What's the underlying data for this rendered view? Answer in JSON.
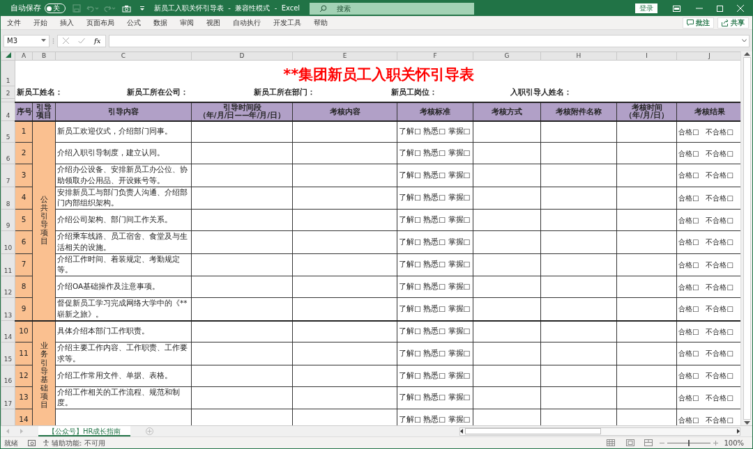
{
  "title_bar": {
    "autosave": {
      "label": "自动保存",
      "on": false,
      "state_text": "关"
    },
    "title": "新员工入职关怀引导表  -  兼容性模式  -  Excel",
    "search": {
      "placeholder": "搜索"
    },
    "signin": "登录"
  },
  "ribbon_tabs": [
    "文件",
    "开始",
    "插入",
    "页面布局",
    "公式",
    "数据",
    "审阅",
    "视图",
    "自动执行",
    "开发工具",
    "帮助"
  ],
  "ribbon_buttons": [
    {
      "kind": "comment",
      "label": "批注"
    },
    {
      "kind": "share",
      "label": "共享"
    }
  ],
  "formula_bar": {
    "name_box": "M3",
    "fx": "fx"
  },
  "column_headers": [
    "A",
    "B",
    "C",
    "D",
    "E",
    "F",
    "G",
    "H",
    "I",
    "J"
  ],
  "sheet": {
    "title": "**集团新员工入职关怀引导表",
    "top_rows": [
      "1",
      "2",
      "4"
    ],
    "info_labels": [
      "新员工姓名：",
      "新员工所在公司：",
      "新员工所在部门：",
      "新员工岗位：",
      "入职引导人姓名："
    ],
    "headings": [
      [
        "序号"
      ],
      [
        "引导",
        "项目"
      ],
      [
        "引导内容"
      ],
      [
        "引导时间段",
        "（年/月/日——年/月/日）"
      ],
      [
        "考核内容"
      ],
      [
        "考核标准"
      ],
      [
        "考核方式"
      ],
      [
        "考核附件名称"
      ],
      [
        "考核时间",
        "（年/月/日）"
      ],
      [
        "考核结果"
      ]
    ],
    "groups": [
      {
        "label": "公共引导项目",
        "rows": [
          {
            "row": "5",
            "seq": "1",
            "content": "新员工欢迎仪式，介绍部门同事。",
            "standard": "了解□ 熟悉□ 掌握□",
            "result": "合格□　不合格□"
          },
          {
            "row": "6",
            "seq": "2",
            "content": "介绍入职引导制度，建立认同。",
            "standard": "了解□ 熟悉□ 掌握□",
            "result": "合格□　不合格□"
          },
          {
            "row": "7",
            "seq": "3",
            "content": "介绍办公设备、安排新员工办公位、协助领取办公用品、开设账号等。",
            "standard": "了解□ 熟悉□ 掌握□",
            "result": "合格□　不合格□"
          },
          {
            "row": "8",
            "seq": "4",
            "content": "安排新员工与部门负责人沟通、介绍部门内部组织架构。",
            "standard": "了解□ 熟悉□ 掌握□",
            "result": "合格□　不合格□"
          },
          {
            "row": "9",
            "seq": "5",
            "content": "介绍公司架构、部门间工作关系。",
            "standard": "了解□ 熟悉□ 掌握□",
            "result": "合格□　不合格□"
          },
          {
            "row": "10",
            "seq": "6",
            "content": "介绍乘车线路、员工宿舍、食堂及与生活相关的设施。",
            "standard": "了解□ 熟悉□ 掌握□",
            "result": "合格□　不合格□"
          },
          {
            "row": "11",
            "seq": "7",
            "content": "介绍工作时间、着装规定、考勤规定等。",
            "standard": "了解□ 熟悉□ 掌握□",
            "result": "合格□　不合格□"
          },
          {
            "row": "12",
            "seq": "8",
            "content": "介绍OA基础操作及注意事项。",
            "standard": "了解□ 熟悉□ 掌握□",
            "result": "合格□　不合格□"
          },
          {
            "row": "13",
            "seq": "9",
            "content": "督促新员工学习完成网络大学中的《**崭新之旅》。",
            "standard": "了解□ 熟悉□ 掌握□",
            "result": "合格□　不合格□"
          }
        ]
      },
      {
        "label": "业务引导基础项目",
        "rows": [
          {
            "row": "14",
            "seq": "10",
            "content": "具体介绍本部门工作职责。",
            "standard": "了解□ 熟悉□ 掌握□",
            "result": "合格□　不合格□"
          },
          {
            "row": "15",
            "seq": "11",
            "content": "介绍主要工作内容、工作职责、工作要求等。",
            "standard": "了解□ 熟悉□ 掌握□",
            "result": "合格□　不合格□"
          },
          {
            "row": "16",
            "seq": "12",
            "content": "介绍工作常用文件、单据、表格。",
            "standard": "了解□ 熟悉□ 掌握□",
            "result": "合格□　不合格□"
          },
          {
            "row": "17",
            "seq": "13",
            "content": "介绍工作相关的工作流程、规范和制度。",
            "standard": "了解□ 熟悉□ 掌握□",
            "result": "合格□　不合格□"
          },
          {
            "seq": "14",
            "standard": "了解□ 熟悉□ 掌握□",
            "result": "合格□　不合格□"
          }
        ]
      }
    ]
  },
  "sheet_tabs": [
    {
      "label": "【公众号】HR成长指南",
      "selected": true
    }
  ],
  "status_bar": {
    "mode": "就绪",
    "accessibility": "辅助功能: 不可用",
    "zoom_slider": {
      "level": 0.5
    },
    "zoom": "100%"
  }
}
